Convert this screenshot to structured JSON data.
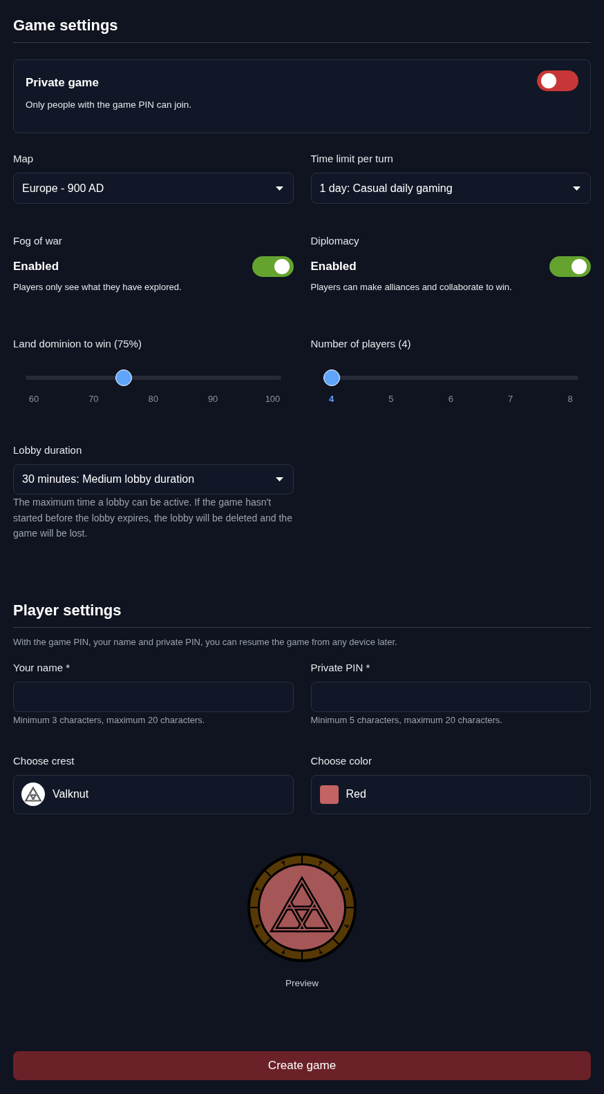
{
  "game_settings": {
    "title": "Game settings",
    "private_game": {
      "title": "Private game",
      "description": "Only people with the game PIN can join.",
      "on": false
    },
    "map": {
      "label": "Map",
      "value": "Europe - 900 AD"
    },
    "time_limit": {
      "label": "Time limit per turn",
      "value": "1 day: Casual daily gaming"
    },
    "fog_of_war": {
      "label": "Fog of war",
      "status": "Enabled",
      "description": "Players only see what they have explored.",
      "on": true
    },
    "diplomacy": {
      "label": "Diplomacy",
      "status": "Enabled",
      "description": "Players can make alliances and collaborate to win.",
      "on": true
    },
    "land_dominion": {
      "label": "Land dominion to win (75%)",
      "level": 0.375,
      "ticks": [
        {
          "label": "60",
          "selected": false
        },
        {
          "label": "70",
          "selected": false
        },
        {
          "label": "80",
          "selected": false
        },
        {
          "label": "90",
          "selected": false
        },
        {
          "label": "100",
          "selected": false
        }
      ]
    },
    "players": {
      "label": "Number of players (4)",
      "level": 0,
      "ticks": [
        {
          "label": "4",
          "selected": true
        },
        {
          "label": "5",
          "selected": false
        },
        {
          "label": "6",
          "selected": false
        },
        {
          "label": "7",
          "selected": false
        },
        {
          "label": "8",
          "selected": false
        }
      ]
    },
    "lobby_duration": {
      "label": "Lobby duration",
      "value": "30 minutes: Medium lobby duration",
      "help": "The maximum time a lobby can be active. If the game hasn't started before the lobby expires, the lobby will be deleted and the game will be lost."
    }
  },
  "player_settings": {
    "title": "Player settings",
    "description": "With the game PIN, your name and private PIN, you can resume the game from any device later.",
    "name": {
      "label": "Your name *",
      "hint": "Minimum 3 characters, maximum 20 characters."
    },
    "pin": {
      "label": "Private PIN *",
      "hint": "Minimum 5 characters, maximum 20 characters."
    },
    "crest": {
      "label": "Choose crest",
      "value": "Valknut"
    },
    "color": {
      "label": "Choose color",
      "value": "Red",
      "color": "#c36363"
    }
  },
  "preview": {
    "label": "Preview"
  },
  "create_button": {
    "label": "Create game"
  }
}
